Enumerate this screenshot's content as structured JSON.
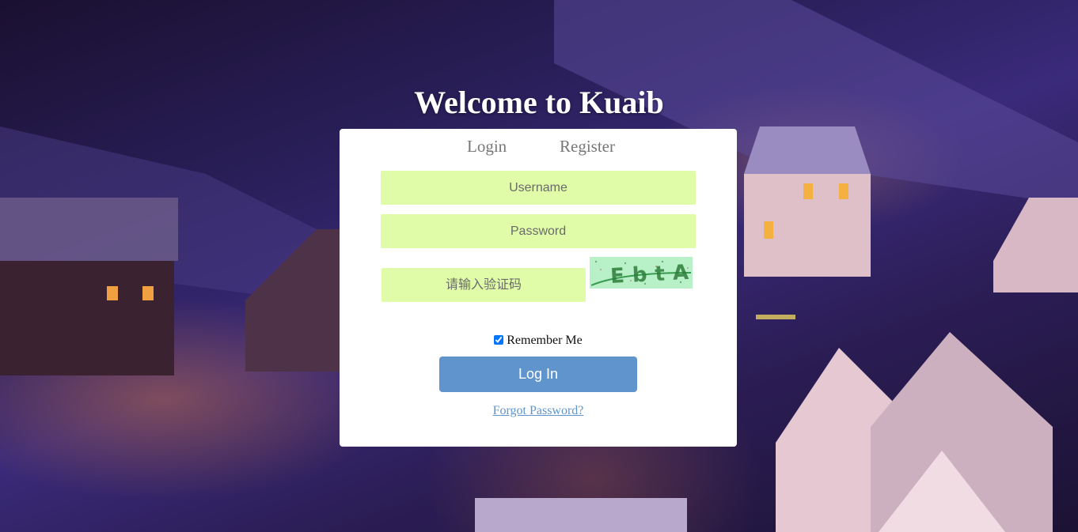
{
  "page": {
    "title": "Welcome to Kuaib"
  },
  "tabs": {
    "login_label": "Login",
    "register_label": "Register"
  },
  "form": {
    "username_placeholder": "Username",
    "password_placeholder": "Password",
    "captcha_placeholder": "请输入验证码",
    "captcha_text": "EbtA",
    "remember_label": "Remember Me",
    "remember_checked": true,
    "login_label": "Log In",
    "forgot_label": "Forgot Password?"
  },
  "colors": {
    "input_bg": "#e0fca8",
    "button_bg": "#5f95cc",
    "link": "#5f95cc",
    "background_tint": "#2a1f5a"
  }
}
